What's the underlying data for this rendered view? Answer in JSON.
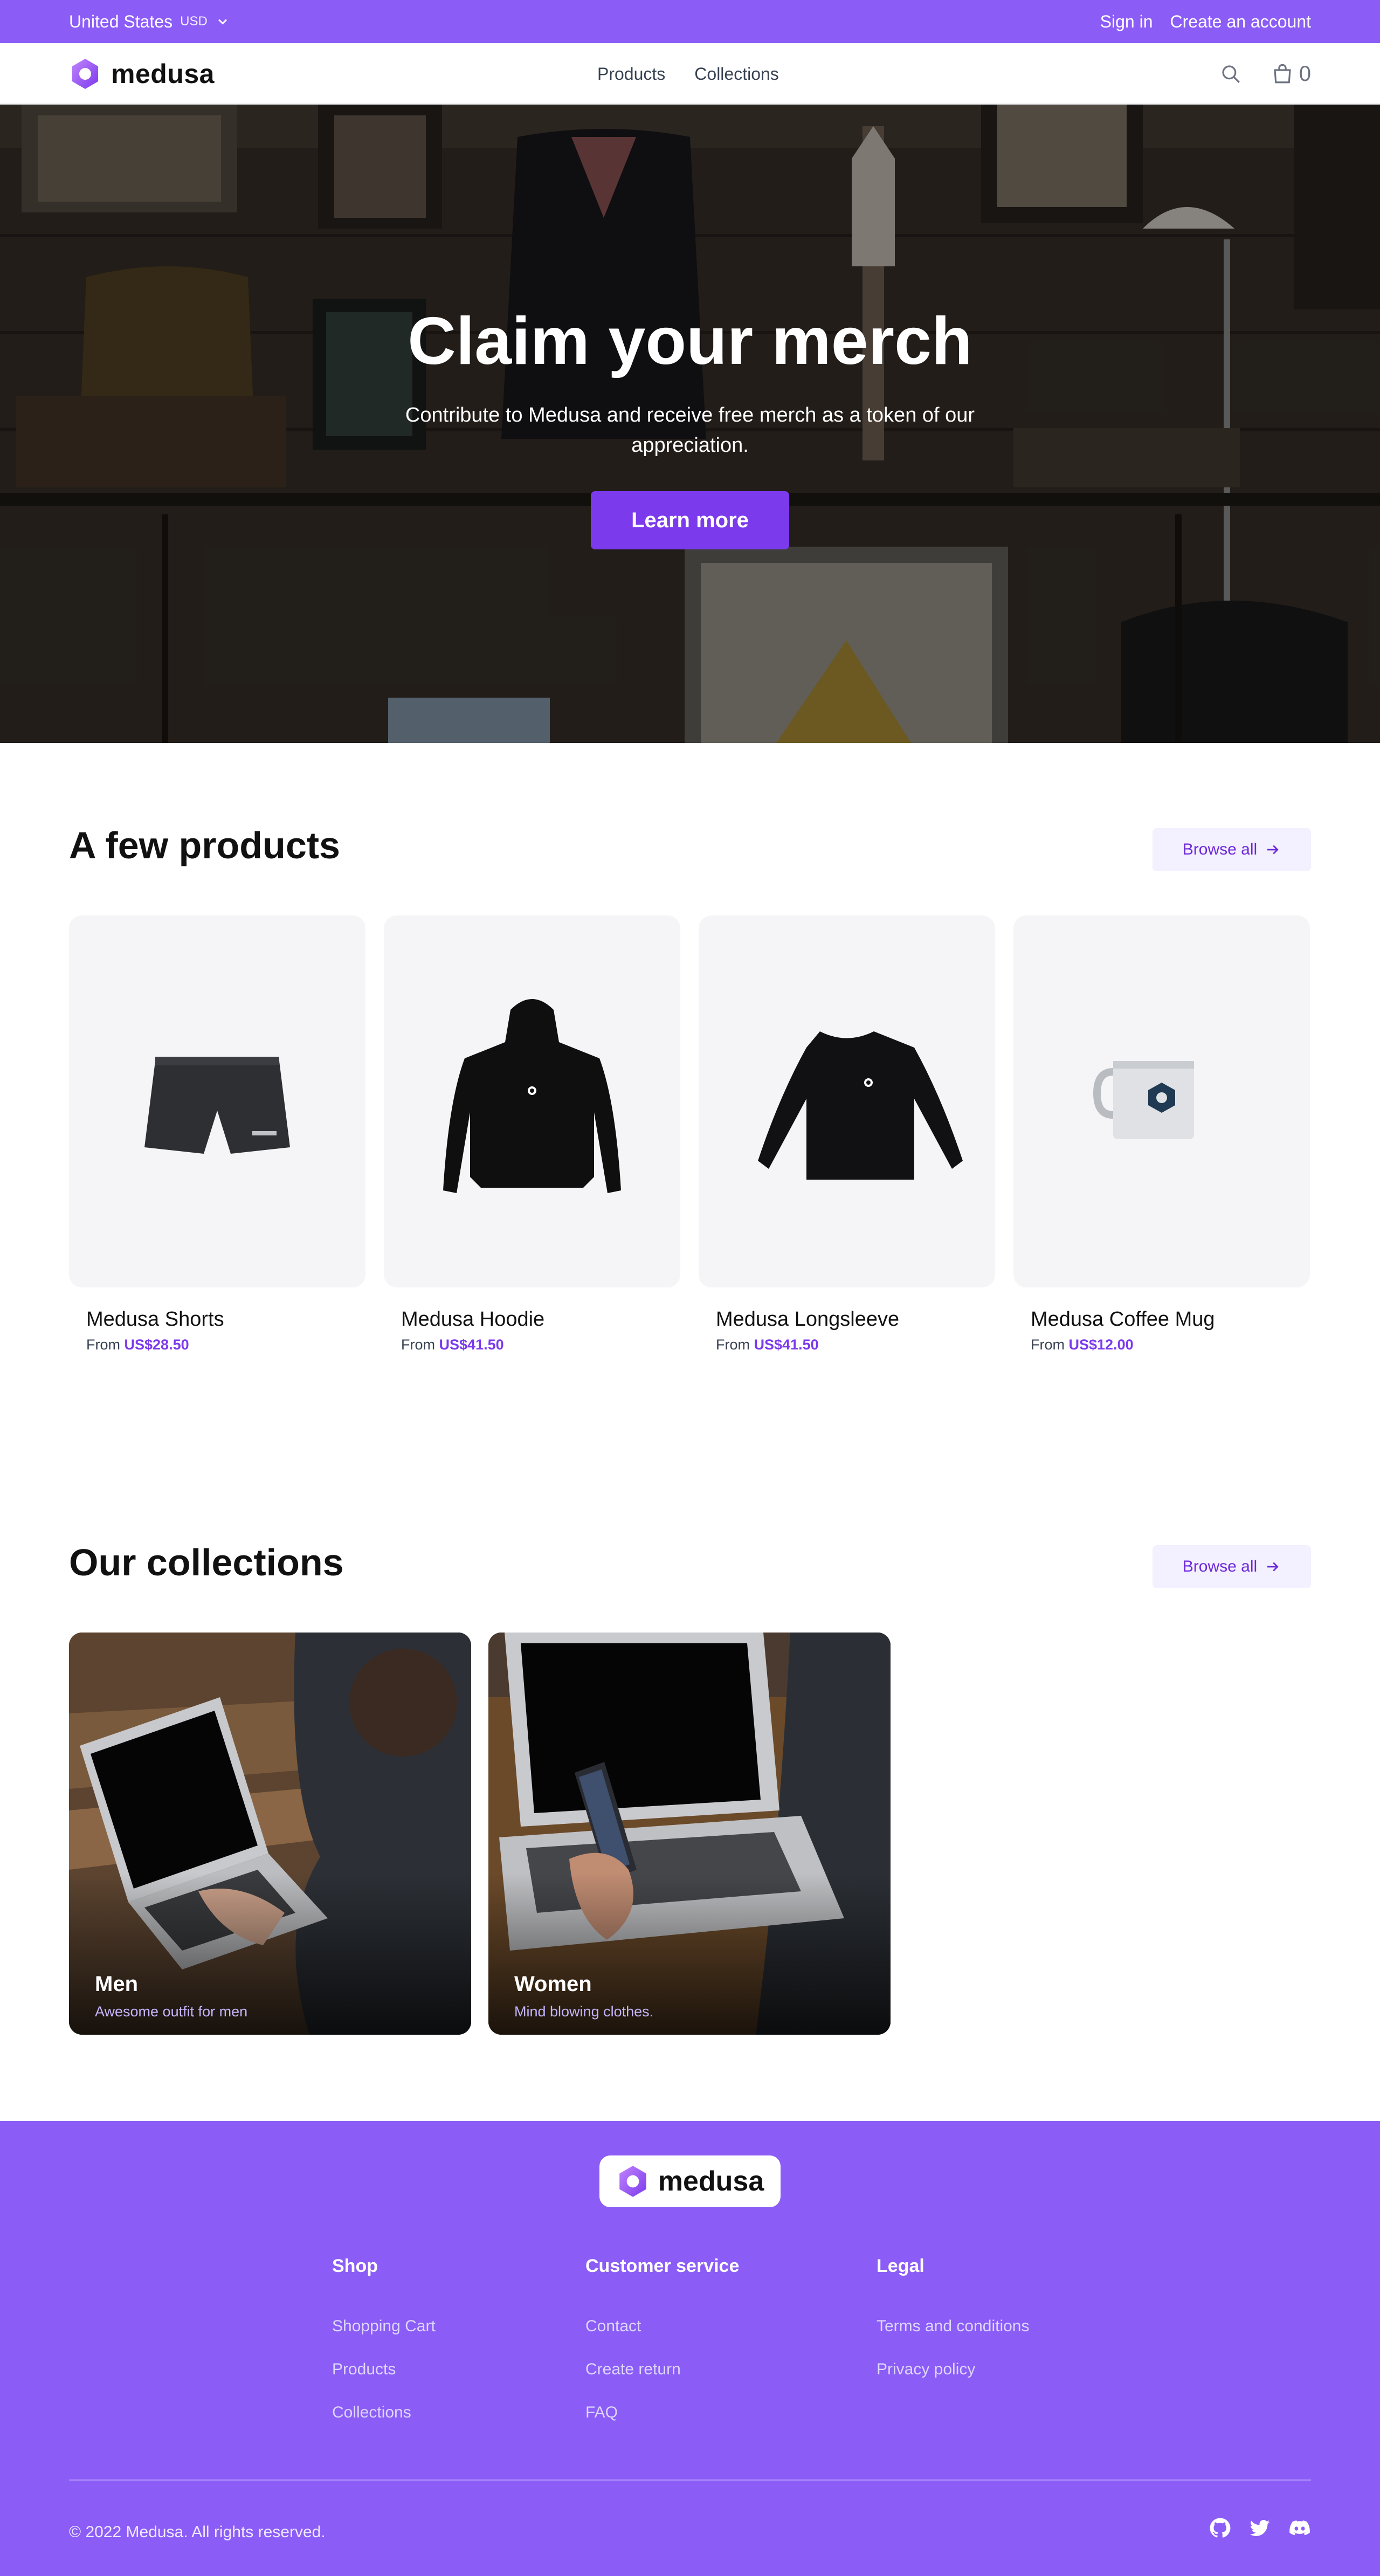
{
  "topbar": {
    "region": "United States",
    "currency": "USD",
    "sign_in": "Sign in",
    "create_account": "Create an account"
  },
  "nav": {
    "brand": "medusa",
    "links": [
      "Products",
      "Collections"
    ],
    "cart_count": "0"
  },
  "hero": {
    "title": "Claim your merch",
    "subtitle": "Contribute to Medusa and receive free merch as a token of our appreciation.",
    "cta": "Learn more"
  },
  "products_section": {
    "title": "A few products",
    "browse_all": "Browse all",
    "items": [
      {
        "name": "Medusa Shorts",
        "from": "From",
        "price": "US$28.50"
      },
      {
        "name": "Medusa Hoodie",
        "from": "From",
        "price": "US$41.50"
      },
      {
        "name": "Medusa Longsleeve",
        "from": "From",
        "price": "US$41.50"
      },
      {
        "name": "Medusa Coffee Mug",
        "from": "From",
        "price": "US$12.00"
      }
    ]
  },
  "collections_section": {
    "title": "Our collections",
    "browse_all": "Browse all",
    "items": [
      {
        "name": "Men",
        "description": "Awesome outfit for men"
      },
      {
        "name": "Women",
        "description": "Mind blowing clothes."
      }
    ]
  },
  "footer": {
    "brand": "medusa",
    "columns": [
      {
        "heading": "Shop",
        "links": [
          "Shopping Cart",
          "Products",
          "Collections"
        ]
      },
      {
        "heading": "Customer service",
        "links": [
          "Contact",
          "Create return",
          "FAQ"
        ]
      },
      {
        "heading": "Legal",
        "links": [
          "Terms and conditions",
          "Privacy policy"
        ]
      }
    ],
    "copyright": "© 2022 Medusa. All rights reserved.",
    "social_icons": [
      "github-icon",
      "twitter-icon",
      "discord-icon"
    ]
  },
  "colors": {
    "brand": "#8b5cf6",
    "accent": "#7c3aed"
  }
}
